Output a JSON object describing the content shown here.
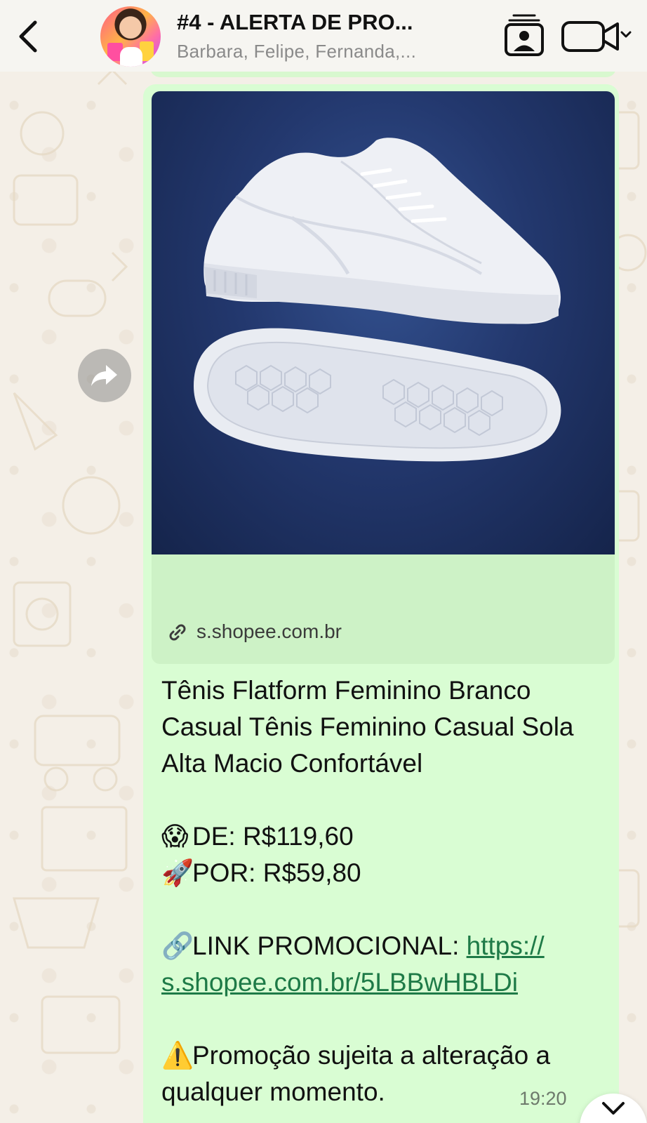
{
  "header": {
    "back_label": "<",
    "chat_title": "#4 - ALERTA DE PRO...",
    "chat_subtitle": "Barbara, Felipe, Fernanda,..."
  },
  "message": {
    "preview": {
      "domain": "s.shopee.com.br",
      "image_subject": "white platform sneakers on navy background"
    },
    "lines": {
      "title_1": "Tênis Flatform Feminino Branco",
      "title_2": "Casual Tênis Feminino Casual Sola",
      "title_3": "Alta Macio Confortável",
      "price_from_emoji": "😱",
      "price_from": "DE: R$119,60",
      "price_to_emoji": "🚀",
      "price_to": "POR: R$59,80",
      "link_emoji": "🔗",
      "link_label": "LINK PROMOCIONAL: ",
      "link_url_1": "https://",
      "link_url_2": "s.shopee.com.br/5LBBwHBLDi",
      "warning_emoji": "⚠️",
      "warning_1": "Promoção sujeita a alteração a",
      "warning_2": "qualquer momento."
    },
    "time": "19:20"
  },
  "icons": {
    "back": "chevron-left-icon",
    "contact": "contact-card-icon",
    "video": "video-camera-icon",
    "forward": "forward-arrow-icon",
    "link": "link-icon",
    "scroll": "chevron-down-icon"
  },
  "colors": {
    "bubble": "#d9fdd3",
    "link": "#1e7a47",
    "header_bg": "#f6f5f1",
    "wallpaper": "#f4efe7"
  }
}
